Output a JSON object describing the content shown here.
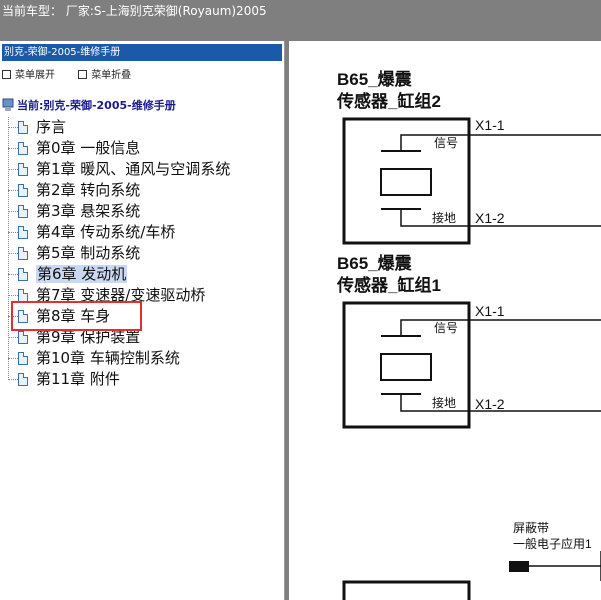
{
  "header": {
    "title": "当前车型：  厂家:S-上海别克荣御(Royaum)2005"
  },
  "sidebar": {
    "title": "别克-荣御-2005-维修手册",
    "expand_label": "菜单展开",
    "collapse_label": "菜单折叠",
    "root_label": "当前:别克-荣御-2005-维修手册",
    "items": [
      {
        "label": "序言"
      },
      {
        "label": "第0章 一般信息"
      },
      {
        "label": "第1章 暖风、通风与空调系统"
      },
      {
        "label": "第2章 转向系统"
      },
      {
        "label": "第3章 悬架系统"
      },
      {
        "label": "第4章 传动系统/车桥"
      },
      {
        "label": "第5章 制动系统"
      },
      {
        "label": "第6章 发动机"
      },
      {
        "label": "第7章 变速器/变速驱动桥"
      },
      {
        "label": "第8章 车身"
      },
      {
        "label": "第9章 保护装置"
      },
      {
        "label": "第10章 车辆控制系统"
      },
      {
        "label": "第11章 附件"
      }
    ],
    "selected_index": 7
  },
  "diagram": {
    "sensor2": {
      "title_1": "B65_爆震",
      "title_2": "传感器_缸组2",
      "signal_label": "信号",
      "ground_label": "接地",
      "pin1": "X1-1",
      "pin2": "X1-2"
    },
    "sensor1": {
      "title_1": "B65_爆震",
      "title_2": "传感器_缸组1",
      "signal_label": "信号",
      "ground_label": "接地",
      "pin1": "X1-1",
      "pin2": "X1-2"
    },
    "shield": {
      "label_1": "屏蔽带",
      "label_2": "一般电子应用1"
    }
  }
}
